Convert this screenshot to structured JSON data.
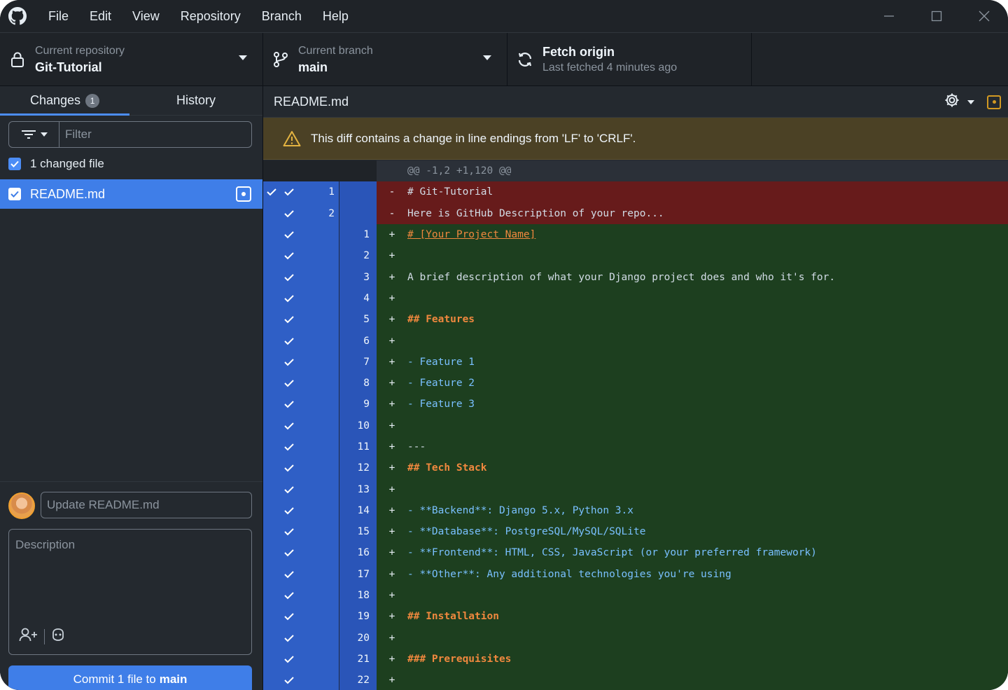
{
  "menu": [
    "File",
    "Edit",
    "View",
    "Repository",
    "Branch",
    "Help"
  ],
  "toolbar": {
    "repo_label": "Current repository",
    "repo_name": "Git-Tutorial",
    "branch_label": "Current branch",
    "branch_name": "main",
    "fetch_title": "Fetch origin",
    "fetch_sub": "Last fetched 4 minutes ago"
  },
  "sidebar": {
    "tab_changes": "Changes",
    "changes_count": "1",
    "tab_history": "History",
    "filter_placeholder": "Filter",
    "changed_files_text": "1 changed file",
    "file_name": "README.md",
    "summary_placeholder": "Update README.md",
    "description_placeholder": "Description",
    "commit_button_prefix": "Commit 1 file to",
    "commit_button_branch": "main"
  },
  "diff": {
    "file_name": "README.md",
    "warning": "This diff contains a change in line endings from 'LF' to 'CRLF'.",
    "hunk_header": "@@ -1,2 +1,120 @@",
    "lines": [
      {
        "type": "del",
        "old": "1",
        "new": "",
        "marker": "-",
        "text": "# Git-Tutorial",
        "style": "plain"
      },
      {
        "type": "del",
        "old": "2",
        "new": "",
        "marker": "-",
        "text": "Here is GitHub Description of your repo...",
        "style": "plain"
      },
      {
        "type": "add",
        "old": "",
        "new": "1",
        "marker": "+",
        "text": "# [Your Project Name]",
        "style": "link"
      },
      {
        "type": "add",
        "old": "",
        "new": "2",
        "marker": "+",
        "text": "",
        "style": "plain"
      },
      {
        "type": "add",
        "old": "",
        "new": "3",
        "marker": "+",
        "text": "A brief description of what your Django project does and who it's for.",
        "style": "plain"
      },
      {
        "type": "add",
        "old": "",
        "new": "4",
        "marker": "+",
        "text": "",
        "style": "plain"
      },
      {
        "type": "add",
        "old": "",
        "new": "5",
        "marker": "+",
        "text": "## Features",
        "style": "heading"
      },
      {
        "type": "add",
        "old": "",
        "new": "6",
        "marker": "+",
        "text": "",
        "style": "plain"
      },
      {
        "type": "add",
        "old": "",
        "new": "7",
        "marker": "+",
        "text": "- Feature 1",
        "style": "list"
      },
      {
        "type": "add",
        "old": "",
        "new": "8",
        "marker": "+",
        "text": "- Feature 2",
        "style": "list"
      },
      {
        "type": "add",
        "old": "",
        "new": "9",
        "marker": "+",
        "text": "- Feature 3",
        "style": "list"
      },
      {
        "type": "add",
        "old": "",
        "new": "10",
        "marker": "+",
        "text": "",
        "style": "plain"
      },
      {
        "type": "add",
        "old": "",
        "new": "11",
        "marker": "+",
        "text": "---",
        "style": "plain"
      },
      {
        "type": "add",
        "old": "",
        "new": "12",
        "marker": "+",
        "text": "## Tech Stack",
        "style": "heading"
      },
      {
        "type": "add",
        "old": "",
        "new": "13",
        "marker": "+",
        "text": "",
        "style": "plain"
      },
      {
        "type": "add",
        "old": "",
        "new": "14",
        "marker": "+",
        "text": "- **Backend**: Django 5.x, Python 3.x",
        "style": "list"
      },
      {
        "type": "add",
        "old": "",
        "new": "15",
        "marker": "+",
        "text": "- **Database**: PostgreSQL/MySQL/SQLite",
        "style": "list"
      },
      {
        "type": "add",
        "old": "",
        "new": "16",
        "marker": "+",
        "text": "- **Frontend**: HTML, CSS, JavaScript (or your preferred framework)",
        "style": "list"
      },
      {
        "type": "add",
        "old": "",
        "new": "17",
        "marker": "+",
        "text": "- **Other**: Any additional technologies you're using",
        "style": "list"
      },
      {
        "type": "add",
        "old": "",
        "new": "18",
        "marker": "+",
        "text": "",
        "style": "plain"
      },
      {
        "type": "add",
        "old": "",
        "new": "19",
        "marker": "+",
        "text": "## Installation",
        "style": "heading"
      },
      {
        "type": "add",
        "old": "",
        "new": "20",
        "marker": "+",
        "text": "",
        "style": "plain"
      },
      {
        "type": "add",
        "old": "",
        "new": "21",
        "marker": "+",
        "text": "### Prerequisites",
        "style": "heading"
      },
      {
        "type": "add",
        "old": "",
        "new": "22",
        "marker": "+",
        "text": "",
        "style": "plain"
      }
    ]
  },
  "colors": {
    "accent": "#3f7ee8",
    "deleted_bg": "#671b1b",
    "added_bg": "#1d3f1f",
    "warning_bg": "#4b4125"
  }
}
